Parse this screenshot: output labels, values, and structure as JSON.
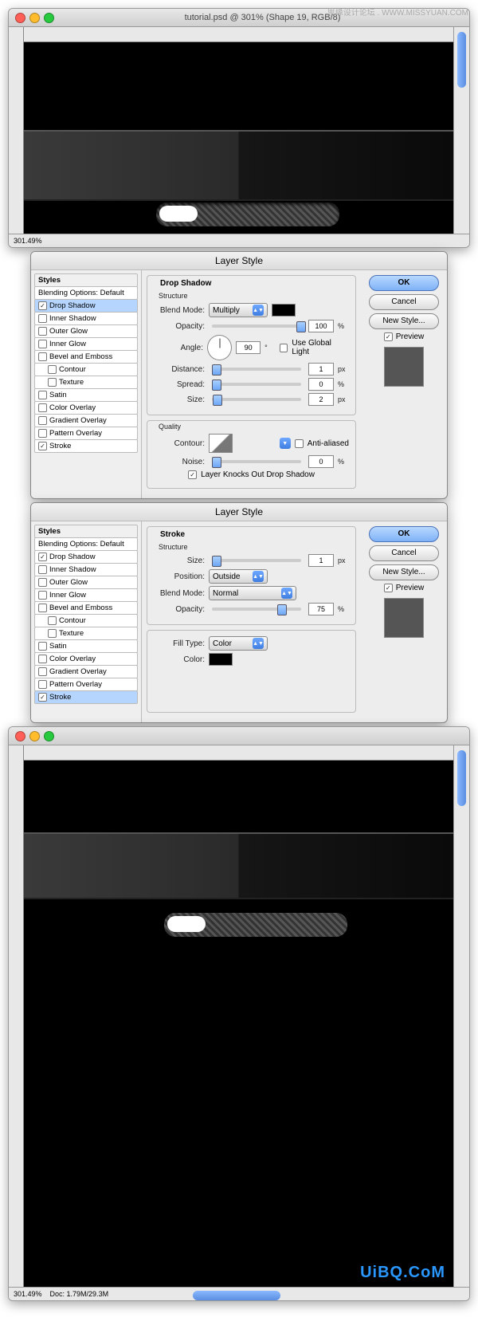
{
  "watermark_top": "思缘设计论坛 . WWW.MISSYUAN.COM",
  "watermark_bottom": "UiBQ.CoM",
  "win1": {
    "title": "tutorial.psd @ 301% (Shape 19, RGB/8)",
    "zoom": "301.49%"
  },
  "win2": {
    "zoom": "301.49%",
    "doc": "Doc: 1.79M/29.3M"
  },
  "styles_list": {
    "header": "Styles",
    "blending": "Blending Options: Default",
    "drop_shadow": "Drop Shadow",
    "inner_shadow": "Inner Shadow",
    "outer_glow": "Outer Glow",
    "inner_glow": "Inner Glow",
    "bevel": "Bevel and Emboss",
    "contour": "Contour",
    "texture": "Texture",
    "satin": "Satin",
    "color_overlay": "Color Overlay",
    "gradient_overlay": "Gradient Overlay",
    "pattern_overlay": "Pattern Overlay",
    "stroke": "Stroke"
  },
  "dlg": {
    "title": "Layer Style",
    "ok": "OK",
    "cancel": "Cancel",
    "new_style": "New Style...",
    "preview": "Preview"
  },
  "ds": {
    "panel": "Drop Shadow",
    "structure": "Structure",
    "blend_mode_l": "Blend Mode:",
    "blend_mode_v": "Multiply",
    "opacity_l": "Opacity:",
    "opacity_v": "100",
    "angle_l": "Angle:",
    "angle_v": "90",
    "use_global": "Use Global Light",
    "distance_l": "Distance:",
    "distance_v": "1",
    "spread_l": "Spread:",
    "spread_v": "0",
    "size_l": "Size:",
    "size_v": "2",
    "px": "px",
    "pct": "%",
    "deg": "°",
    "quality": "Quality",
    "contour_l": "Contour:",
    "anti": "Anti-aliased",
    "noise_l": "Noise:",
    "noise_v": "0",
    "knockout": "Layer Knocks Out Drop Shadow"
  },
  "st": {
    "panel": "Stroke",
    "structure": "Structure",
    "size_l": "Size:",
    "size_v": "1",
    "px": "px",
    "position_l": "Position:",
    "position_v": "Outside",
    "blend_mode_l": "Blend Mode:",
    "blend_mode_v": "Normal",
    "opacity_l": "Opacity:",
    "opacity_v": "75",
    "pct": "%",
    "fill_type_l": "Fill Type:",
    "fill_type_v": "Color",
    "color_l": "Color:"
  }
}
